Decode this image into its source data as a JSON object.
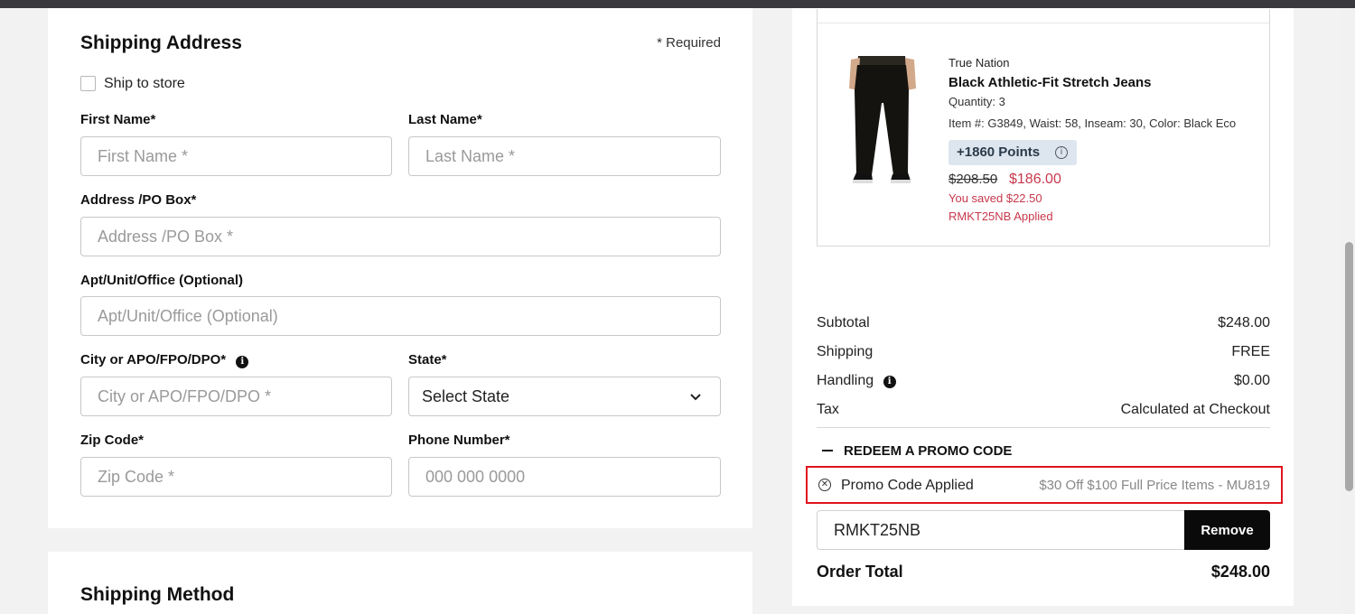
{
  "shipping": {
    "title": "Shipping Address",
    "required_note": "* Required",
    "ship_to_store": "Ship to store",
    "first_name": {
      "label": "First Name*",
      "placeholder": "First Name *"
    },
    "last_name": {
      "label": "Last Name*",
      "placeholder": "Last Name *"
    },
    "address": {
      "label": "Address /PO Box*",
      "placeholder": "Address /PO Box *"
    },
    "apt": {
      "label": "Apt/Unit/Office (Optional)",
      "placeholder": "Apt/Unit/Office (Optional)"
    },
    "city": {
      "label": "City or APO/FPO/DPO*",
      "placeholder": "City or APO/FPO/DPO *"
    },
    "state": {
      "label": "State*",
      "selected": "Select State"
    },
    "zip": {
      "label": "Zip Code*",
      "placeholder": "Zip Code *"
    },
    "phone": {
      "label": "Phone Number*",
      "placeholder": "000 000 0000"
    }
  },
  "shipping_method": {
    "title": "Shipping Method"
  },
  "product": {
    "brand": "True Nation",
    "name": "Black Athletic-Fit Stretch Jeans",
    "quantity": "Quantity: 3",
    "details": "Item #: G3849, Waist: 58, Inseam: 30, Color: Black Eco",
    "points": "+1860 Points",
    "old_price": "$208.50",
    "new_price": "$186.00",
    "saved": "You saved $22.50",
    "promo_applied": "RMKT25NB Applied"
  },
  "summary": {
    "subtotal_label": "Subtotal",
    "subtotal_value": "$248.00",
    "shipping_label": "Shipping",
    "shipping_value": "FREE",
    "handling_label": "Handling",
    "handling_value": "$0.00",
    "tax_label": "Tax",
    "tax_value": "Calculated at Checkout"
  },
  "promo": {
    "toggle_label": "REDEEM A PROMO CODE",
    "applied_text": "Promo Code Applied",
    "applied_desc": "$30 Off $100 Full Price Items - MU819",
    "code_value": "RMKT25NB",
    "remove_label": "Remove"
  },
  "total": {
    "label": "Order Total",
    "value": "$248.00"
  },
  "colors": {
    "sale_red": "#c8384c",
    "highlight_border": "#e0141e",
    "button_black": "#0a0a0a"
  }
}
